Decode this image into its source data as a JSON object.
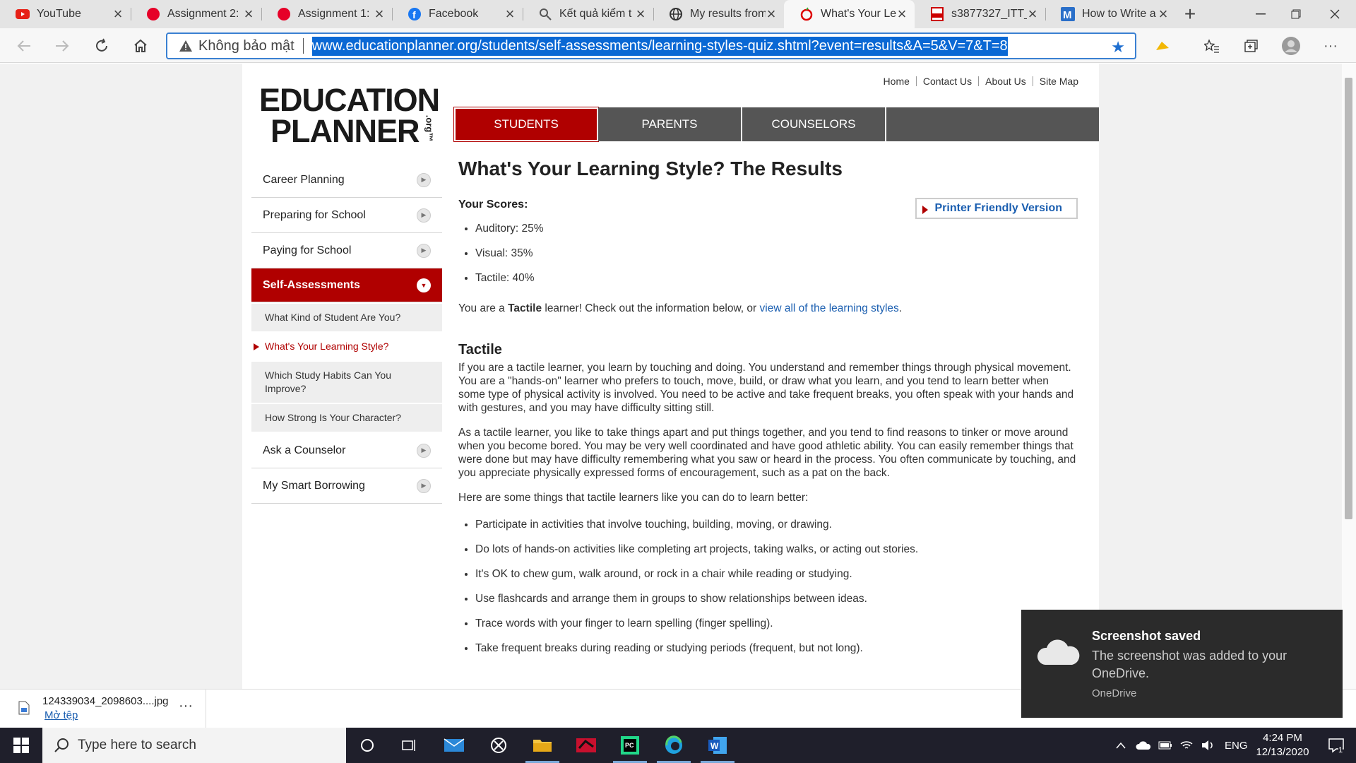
{
  "browser": {
    "tabs": [
      {
        "label": "YouTube",
        "icon": "youtube-icon"
      },
      {
        "label": "Assignment 2:",
        "icon": "rmit-icon"
      },
      {
        "label": "Assignment 1:",
        "icon": "rmit-icon"
      },
      {
        "label": "Facebook",
        "icon": "facebook-icon"
      },
      {
        "label": "Kết quả kiểm t",
        "icon": "search-doc-icon"
      },
      {
        "label": "My results from",
        "icon": "globe-icon"
      },
      {
        "label": "What's Your Le",
        "icon": "apple-icon"
      },
      {
        "label": "s3877327_ITT_",
        "icon": "pdf-icon"
      },
      {
        "label": "How to Write a",
        "icon": "medium-icon"
      }
    ],
    "active_tab": 6,
    "security_label": "Không bảo mật",
    "url": "www.educationplanner.org/students/self-assessments/learning-styles-quiz.shtml?event=results&A=5&V=7&T=8"
  },
  "site": {
    "logo_line1": "EDUCATION",
    "logo_line2": "PLANNER",
    "logo_org": ".org™",
    "top_links": [
      "Home",
      "Contact Us",
      "About Us",
      "Site Map"
    ],
    "main_nav": [
      "STUDENTS",
      "PARENTS",
      "COUNSELORS"
    ],
    "left_nav": [
      {
        "label": "Career Planning"
      },
      {
        "label": "Preparing for School"
      },
      {
        "label": "Paying for School"
      },
      {
        "label": "Self-Assessments"
      }
    ],
    "sub_nav": [
      "What Kind of Student Are You?",
      "What's Your Learning Style?",
      "Which Study Habits Can You Improve?",
      "How Strong Is Your Character?"
    ],
    "left_nav_after": [
      {
        "label": "Ask a Counselor"
      },
      {
        "label": "My Smart Borrowing"
      }
    ]
  },
  "content": {
    "title": "What's Your Learning Style? The Results",
    "scores_heading": "Your Scores:",
    "printer_label": "Printer Friendly Version",
    "scores": [
      "Auditory: 25%",
      "Visual: 35%",
      "Tactile: 40%"
    ],
    "result_prefix": "You are a ",
    "result_style": "Tactile",
    "result_mid": " learner! Check out the information below, or ",
    "result_link": "view all of the learning styles",
    "result_end": ".",
    "section_title": "Tactile",
    "para1": "If you are a tactile learner, you learn by touching and doing. You understand and remember things through physical movement. You are a \"hands-on\" learner who prefers to touch, move, build, or draw what you learn, and you tend to learn better when some type of physical activity is involved. You need to be active and take frequent breaks, you often speak with your hands and with gestures, and you may have difficulty sitting still.",
    "para2": "As a tactile learner, you like to take things apart and put things together, and you tend to find reasons to tinker or move around when you become bored. You may be very well coordinated and have good athletic ability. You can easily remember things that were done but may have difficulty remembering what you saw or heard in the process. You often communicate by touching, and you appreciate physically expressed forms of encouragement, such as a pat on the back.",
    "tips_intro": "Here are some things that tactile learners like you can do to learn better:",
    "tips": [
      "Participate in activities that involve touching, building, moving, or drawing.",
      "Do lots of hands-on activities like completing art projects, taking walks, or acting out stories.",
      "It's OK to chew gum, walk around, or rock in a chair while reading or studying.",
      "Use flashcards and arrange them in groups to show relationships between ideas.",
      "Trace words with your finger to learn spelling (finger spelling).",
      "Take frequent breaks during reading or studying periods (frequent, but not long)."
    ]
  },
  "download": {
    "filename": "124339034_2098603....jpg",
    "open_label": "Mở tệp"
  },
  "toast": {
    "title": "Screenshot saved",
    "body": "The screenshot was added to your OneDrive.",
    "source": "OneDrive"
  },
  "taskbar": {
    "search_placeholder": "Type here to search",
    "language": "ENG",
    "time": "4:24 PM",
    "date": "12/13/2020",
    "notification_count": "1"
  },
  "colors": {
    "brand_red": "#b00000",
    "link_blue": "#1a5eb0",
    "nav_gray": "#555555"
  }
}
